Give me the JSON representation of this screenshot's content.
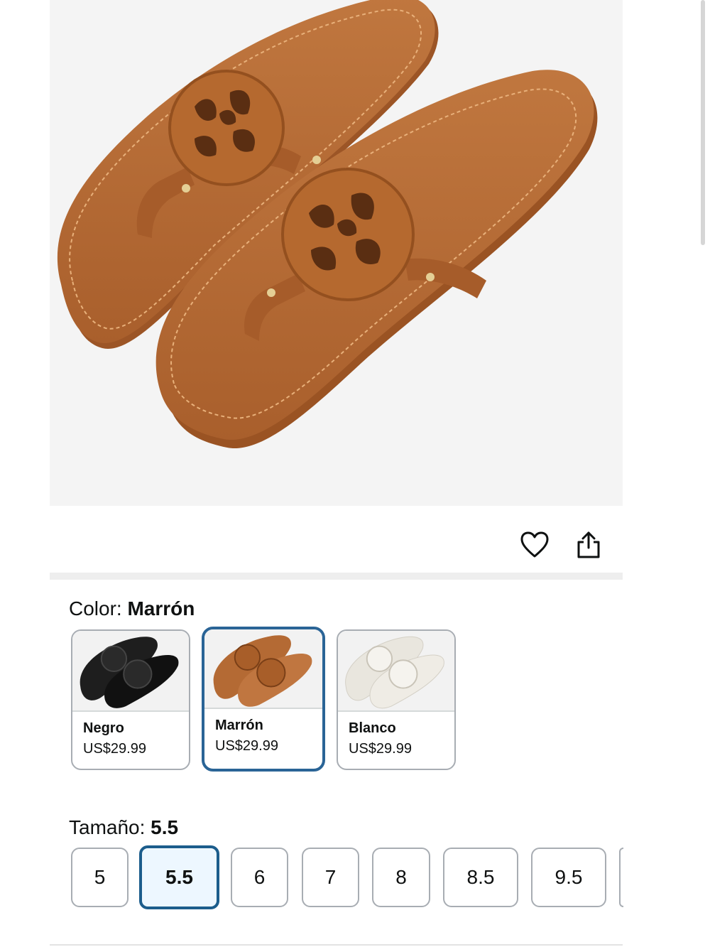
{
  "product": {
    "image_icon": "brown-thong-sandals-photo",
    "color_label": "Color: ",
    "color_value": "Marrón",
    "size_label": "Tamaño: ",
    "size_value": "5.5"
  },
  "actions": {
    "wishlist_icon": "heart-icon",
    "share_icon": "share-icon"
  },
  "colors": [
    {
      "name": "Negro",
      "price": "US$29.99",
      "selected": false,
      "hex": "#1f1f1f"
    },
    {
      "name": "Marrón",
      "price": "US$29.99",
      "selected": true,
      "hex": "#b86b35"
    },
    {
      "name": "Blanco",
      "price": "US$29.99",
      "selected": false,
      "hex": "#ece9e2"
    }
  ],
  "sizes": [
    "5",
    "5.5",
    "6",
    "7",
    "8",
    "8.5",
    "9.5"
  ],
  "selected_size": "5.5",
  "theme": {
    "selected_border": "#2a6496",
    "selected_size_bg": "#edf7ff",
    "swatch_border": "#a8adb3"
  }
}
